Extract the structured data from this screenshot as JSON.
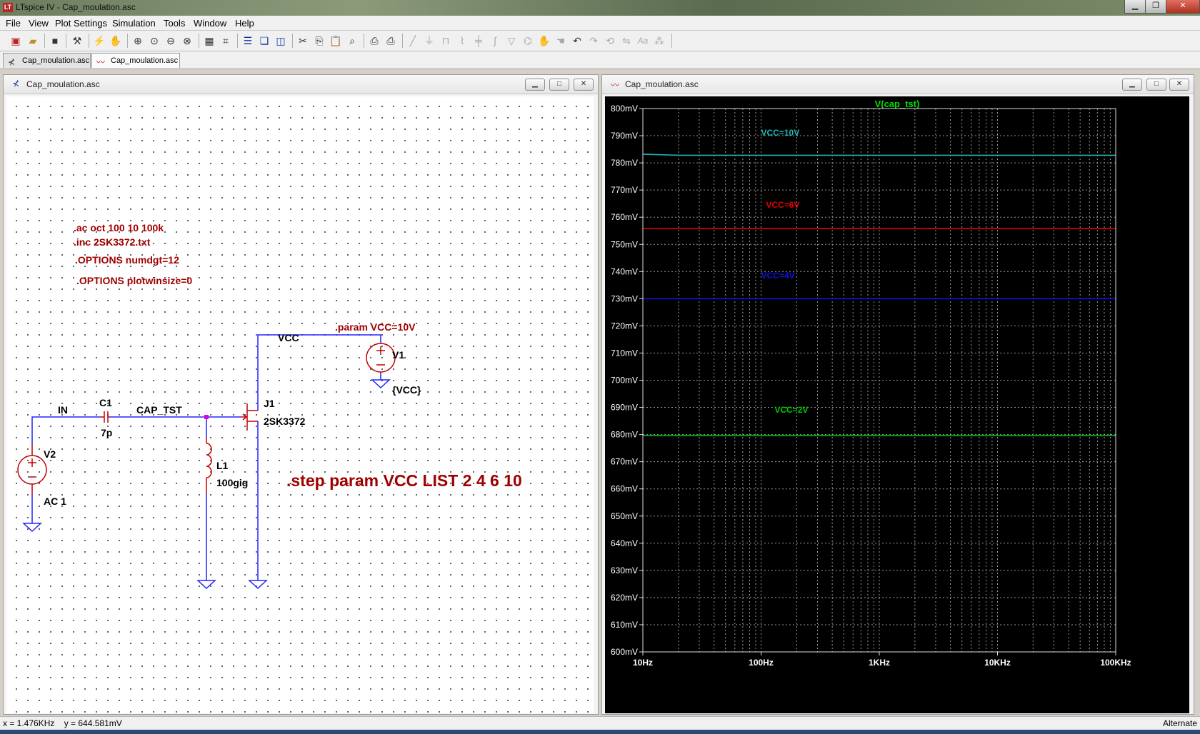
{
  "window": {
    "title": "LTspice IV - Cap_moulation.asc",
    "app_badge": "LT"
  },
  "menu": [
    "File",
    "View",
    "Plot Settings",
    "Simulation",
    "Tools",
    "Window",
    "Help"
  ],
  "tabs": [
    {
      "label": "Cap_moulation.asc",
      "icon": "schematic-icon",
      "active": false
    },
    {
      "label": "Cap_moulation.asc",
      "icon": "waveform-icon",
      "active": true
    }
  ],
  "schematic_window": {
    "title": "Cap_moulation.asc",
    "directives": [
      ".ac oct 100 10 100k",
      ".inc 2SK3372.txt",
      ".OPTIONS numdgt=12",
      ".OPTIONS plotwinsize=0"
    ],
    "param_directive": ".param VCC=10V",
    "step_directive": ".step param VCC LIST 2 4 6 10",
    "nets": {
      "in": "IN",
      "cap_tst": "CAP_TST",
      "vcc": "VCC"
    },
    "components": {
      "c1": {
        "name": "C1",
        "value": "7p"
      },
      "v2": {
        "name": "V2",
        "value": "AC 1"
      },
      "l1": {
        "name": "L1",
        "value": "100gig"
      },
      "j1": {
        "name": "J1",
        "value": "2SK3372"
      },
      "v1": {
        "name": "V1",
        "value": "{VCC}"
      }
    },
    "colors": {
      "wire": "#2323ff",
      "component": "#c00000",
      "directive": "#a00000",
      "junction": "#e000e0"
    }
  },
  "plot_window": {
    "title": "Cap_moulation.asc",
    "colors": {
      "background": "#000000",
      "grid": "#9a9a9a",
      "axis_text": "#ffffff",
      "trace_label": "#00e000"
    }
  },
  "chart_data": {
    "type": "line",
    "title": "V(cap_tst)",
    "x_scale": "log",
    "xlim": [
      10,
      100000
    ],
    "ylim": [
      600,
      800
    ],
    "y_unit": "mV",
    "y_ticks": [
      "800mV",
      "790mV",
      "780mV",
      "770mV",
      "760mV",
      "750mV",
      "740mV",
      "730mV",
      "720mV",
      "710mV",
      "700mV",
      "690mV",
      "680mV",
      "670mV",
      "660mV",
      "650mV",
      "640mV",
      "630mV",
      "620mV",
      "610mV",
      "600mV"
    ],
    "x_ticks": [
      {
        "value": 10,
        "label": "10Hz"
      },
      {
        "value": 100,
        "label": "100Hz"
      },
      {
        "value": 1000,
        "label": "1KHz"
      },
      {
        "value": 10000,
        "label": "10KHz"
      },
      {
        "value": 100000,
        "label": "100KHz"
      }
    ],
    "grid": true,
    "series": [
      {
        "name": "VCC=10V",
        "color": "#20b2b2",
        "x": [
          10,
          20,
          100000
        ],
        "y": [
          783.2,
          782.8,
          782.8
        ],
        "label_at": [
          100,
          790
        ]
      },
      {
        "name": "VCC=6V",
        "color": "#e00000",
        "x": [
          10,
          100000
        ],
        "y": [
          755.8,
          755.8
        ],
        "label_at": [
          110,
          763.5
        ]
      },
      {
        "name": "VCC=4V",
        "color": "#1010e0",
        "x": [
          10,
          100000
        ],
        "y": [
          730.0,
          730.0
        ],
        "label_at": [
          100,
          737.5
        ]
      },
      {
        "name": "VCC=2V",
        "color": "#00cc00",
        "x": [
          10,
          100000
        ],
        "y": [
          679.6,
          679.6
        ],
        "label_at": [
          130,
          688
        ]
      }
    ]
  },
  "status": {
    "coords": "x = 1.476KHz    y = 644.581mV",
    "mode": "Alternate"
  }
}
